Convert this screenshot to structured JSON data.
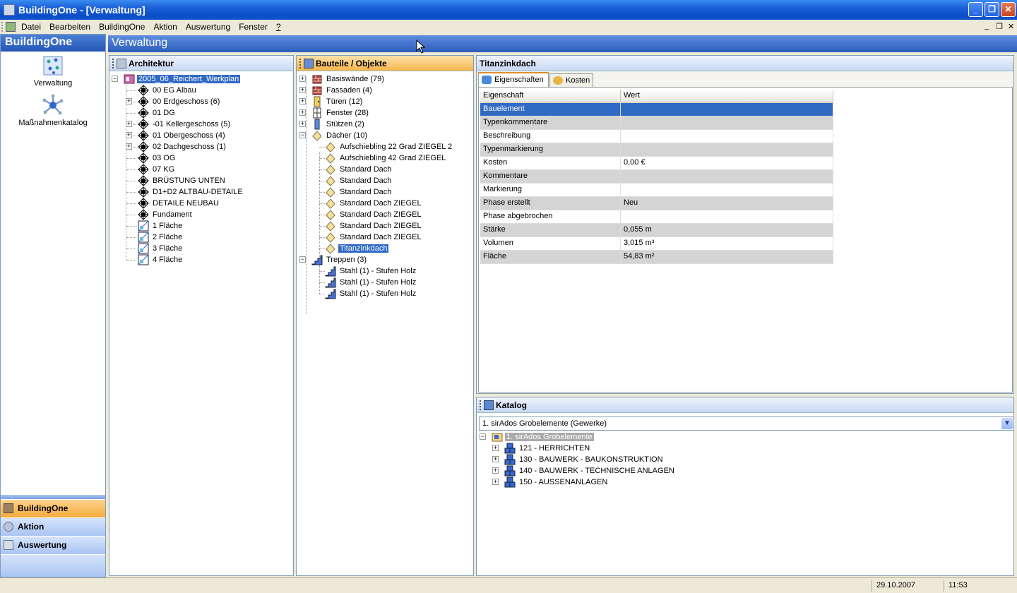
{
  "window": {
    "title": "BuildingOne - [Verwaltung]"
  },
  "menu": [
    "Datei",
    "Bearbeiten",
    "BuildingOne",
    "Aktion",
    "Auswertung",
    "Fenster",
    "?"
  ],
  "left_panel": {
    "header": "BuildingOne",
    "icons": [
      {
        "label": "Verwaltung",
        "icon": "grid-dots-icon"
      },
      {
        "label": "Maßnahmenkatalog",
        "icon": "star-network-icon"
      }
    ],
    "nav_buttons": [
      {
        "label": "BuildingOne",
        "active": true
      },
      {
        "label": "Aktion",
        "active": false
      },
      {
        "label": "Auswertung",
        "active": false
      }
    ]
  },
  "main": {
    "header": "Verwaltung"
  },
  "architektur": {
    "header": "Architektur",
    "root": "2005_06_Reichert_Werkplan",
    "items": [
      "00 EG Albau",
      "00 Erdgeschoss (6)",
      "01 DG",
      "-01 Kellergeschoss (5)",
      "01 Obergeschoss (4)",
      "02 Dachgeschoss (1)",
      "03 OG",
      "07 KG",
      "BRÜSTUNG UNTEN",
      "D1+D2  ALTBAU-DETAILE",
      "DETAILE NEUBAU",
      "Fundament",
      "1 Fläche",
      "2 Fläche",
      "3 Fläche",
      "4 Fläche"
    ]
  },
  "bauteile": {
    "header": "Bauteile / Objekte",
    "groups": [
      "Basiswände (79)",
      "Fassaden (4)",
      "Türen (12)",
      "Fenster (28)",
      "Stützen (2)",
      "Dächer (10)"
    ],
    "daecher": [
      "Aufschiebling  22 Grad  ZIEGEL 2",
      "Aufschiebling  42 Grad  ZIEGEL",
      "Standard Dach",
      "Standard Dach",
      "Standard Dach",
      "Standard Dach ZIEGEL",
      "Standard Dach ZIEGEL",
      "Standard Dach ZIEGEL",
      "Standard Dach ZIEGEL",
      "Titanzinkdach"
    ],
    "treppen_label": "Treppen (3)",
    "treppen": [
      "Stahl (1) - Stufen Holz",
      "Stahl (1) - Stufen Holz",
      "Stahl (1) - Stufen Holz"
    ]
  },
  "detail": {
    "header": "Titanzinkdach",
    "tabs": [
      "Eigenschaften",
      "Kosten"
    ],
    "col_headers": [
      "Eigenschaft",
      "Wert"
    ],
    "rows": [
      [
        "Bauelement",
        ""
      ],
      [
        "Typenkommentare",
        ""
      ],
      [
        "Beschreibung",
        ""
      ],
      [
        "Typenmarkierung",
        ""
      ],
      [
        "Kosten",
        "0,00 €"
      ],
      [
        "Kommentare",
        ""
      ],
      [
        "Markierung",
        ""
      ],
      [
        "Phase erstellt",
        "Neu"
      ],
      [
        "Phase abgebrochen",
        ""
      ],
      [
        "Stärke",
        "0,055 m"
      ],
      [
        "Volumen",
        "3,015 m³"
      ],
      [
        "Fläche",
        "54,83 m²"
      ]
    ]
  },
  "katalog": {
    "header": "Katalog",
    "combo_value": "1. sirAdos Grobelemente (Gewerke)",
    "root": "1. sirAdos Grobelemente",
    "items": [
      "121 - HERRICHTEN",
      "130 - BAUWERK - BAUKONSTRUKTION",
      "140 - BAUWERK - TECHNISCHE ANLAGEN",
      "150 - AUSSENANLAGEN"
    ]
  },
  "status": {
    "date": "29.10.2007",
    "time": "11:53"
  },
  "colors": {
    "titlebar": "#0a4ec8",
    "selection": "#316ac5",
    "nav_active": "#f4ab3e"
  }
}
